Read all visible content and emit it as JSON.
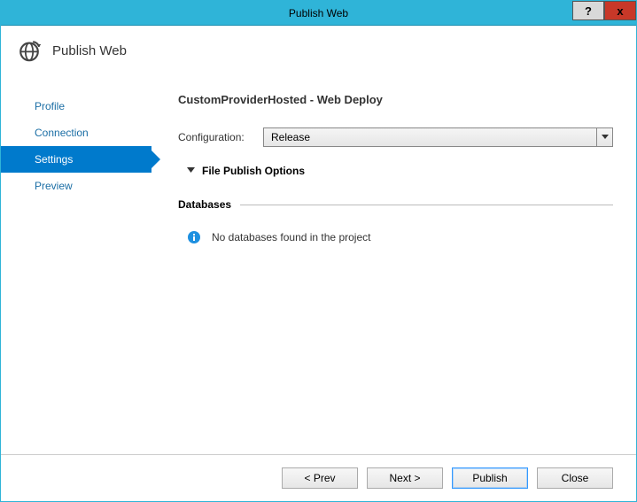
{
  "window": {
    "title": "Publish Web",
    "help": "?",
    "close": "x"
  },
  "header": {
    "title": "Publish Web"
  },
  "sidebar": {
    "items": [
      {
        "label": "Profile"
      },
      {
        "label": "Connection"
      },
      {
        "label": "Settings"
      },
      {
        "label": "Preview"
      }
    ]
  },
  "main": {
    "title": "CustomProviderHosted - Web Deploy",
    "config_label": "Configuration:",
    "config_value": "Release",
    "expander_label": "File Publish Options",
    "databases_header": "Databases",
    "databases_empty": "No databases found in the project"
  },
  "footer": {
    "prev": "< Prev",
    "next": "Next >",
    "publish": "Publish",
    "close": "Close"
  }
}
